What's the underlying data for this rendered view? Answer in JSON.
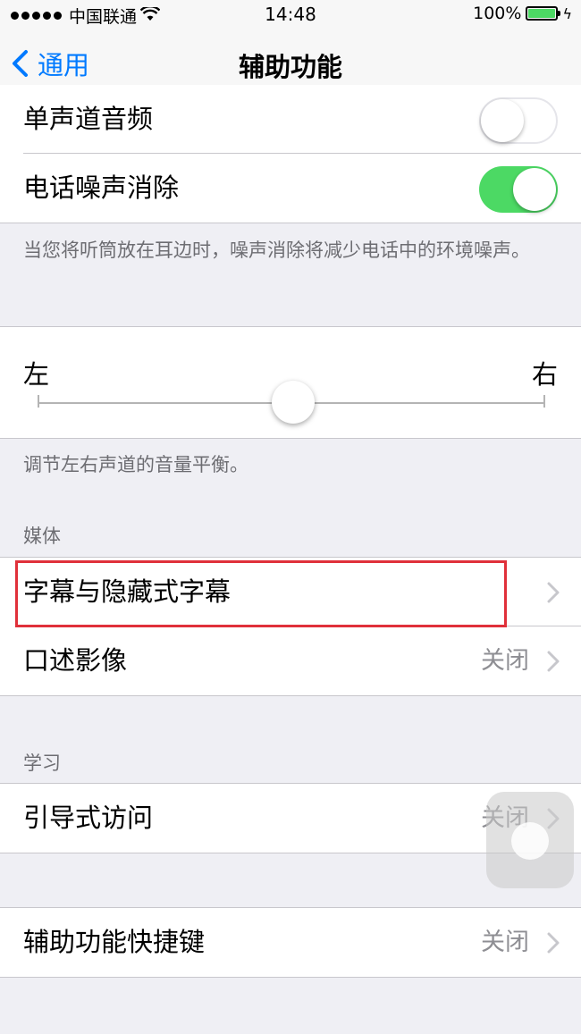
{
  "status_bar": {
    "carrier": "中国联通",
    "time": "14:48",
    "battery": "100%"
  },
  "nav": {
    "back_label": "通用",
    "title": "辅助功能"
  },
  "audio": {
    "mono_audio_label": "单声道音频",
    "mono_audio_on": false,
    "noise_cancel_label": "电话噪声消除",
    "noise_cancel_on": true,
    "noise_cancel_footer": "当您将听筒放在耳边时，噪声消除将减少电话中的环境噪声。"
  },
  "balance": {
    "left_label": "左",
    "right_label": "右",
    "value": 0.5,
    "footer": "调节左右声道的音量平衡。"
  },
  "media": {
    "header": "媒体",
    "subtitles_label": "字幕与隐藏式字幕",
    "audio_desc_label": "口述影像",
    "audio_desc_value": "关闭"
  },
  "learning": {
    "header": "学习",
    "guided_access_label": "引导式访问",
    "guided_access_value": "关闭"
  },
  "shortcut": {
    "label": "辅助功能快捷键",
    "value": "关闭"
  },
  "colors": {
    "accent": "#007aff",
    "toggle_on": "#4cd964",
    "highlight": "#e0303a"
  }
}
